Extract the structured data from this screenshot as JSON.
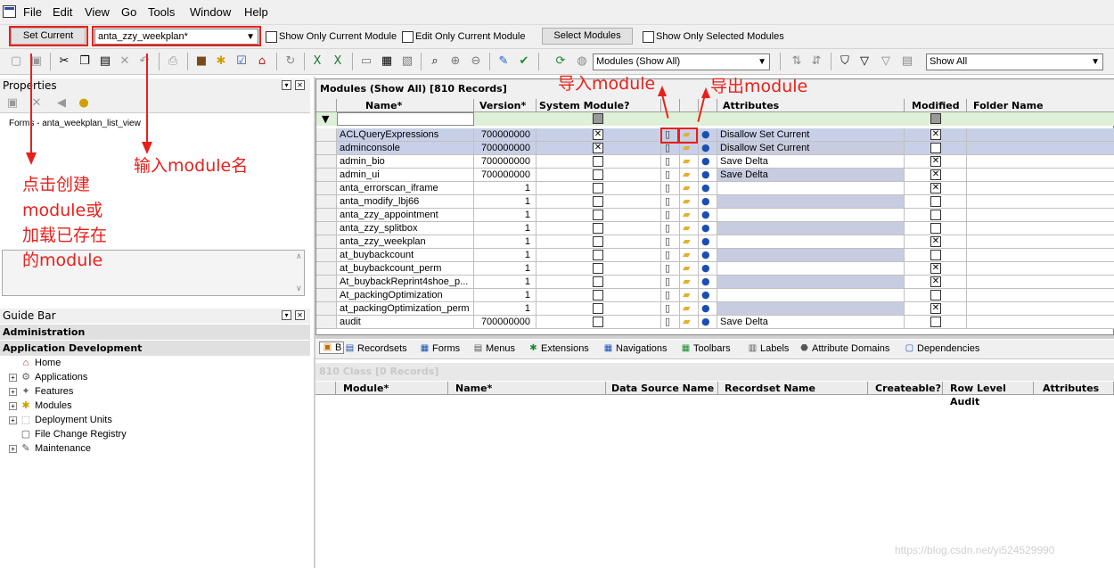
{
  "menubar": {
    "items": [
      "File",
      "Edit",
      "View",
      "Go",
      "Tools",
      "Window",
      "Help"
    ]
  },
  "toolbar1": {
    "set_current_label": "Set Current",
    "module_input_value": "anta_zzy_weekplan*",
    "show_only_current_module": "Show Only Current Module",
    "edit_only_current_module": "Edit Only Current Module",
    "select_modules_label": "Select Modules",
    "show_only_selected_modules": "Show Only Selected Modules"
  },
  "toolbar2": {
    "modules_combo_value": "Modules (Show All)",
    "show_all_combo_value": "Show All"
  },
  "properties": {
    "title": "Properties",
    "form_path": "Forms - anta_weekplan_list_view"
  },
  "guide_bar": {
    "title": "Guide Bar",
    "groups": [
      "Administration",
      "Application Development"
    ],
    "items": [
      {
        "label": "Home",
        "expandable": false,
        "icon": "home-icon"
      },
      {
        "label": "Applications",
        "expandable": true,
        "icon": "applications-icon"
      },
      {
        "label": "Features",
        "expandable": true,
        "icon": "features-icon"
      },
      {
        "label": "Modules",
        "expandable": true,
        "icon": "modules-icon"
      },
      {
        "label": "Deployment Units",
        "expandable": true,
        "icon": "deployment-units-icon"
      },
      {
        "label": "File Change Registry",
        "expandable": false,
        "icon": "file-icon"
      },
      {
        "label": "Maintenance",
        "expandable": true,
        "icon": "wrench-icon"
      }
    ]
  },
  "annotations": {
    "click_create": [
      "点击创建",
      "module或",
      "加载已存在",
      "的module"
    ],
    "input_module_name": "输入module名",
    "import_module": "导入module",
    "export_module": "导出module"
  },
  "modules_grid": {
    "title": "Modules (Show All) [810 Records]",
    "columns": [
      "Name*",
      "Version*",
      "System Module?",
      "",
      "",
      "",
      "Attributes",
      "Modified",
      "Folder Name"
    ],
    "rows": [
      {
        "name": "ACLQueryExpressions",
        "version": "700000000",
        "system": true,
        "attributes": "Disallow Set Current",
        "modified": true,
        "selected": true
      },
      {
        "name": "adminconsole",
        "version": "700000000",
        "system": true,
        "attributes": "Disallow Set Current",
        "modified": false,
        "selected": true
      },
      {
        "name": "admin_bio",
        "version": "700000000",
        "system": false,
        "attributes": "Save Delta",
        "modified": true,
        "selected": false
      },
      {
        "name": "admin_ui",
        "version": "700000000",
        "system": false,
        "attributes": "Save Delta",
        "modified": true,
        "selected": false
      },
      {
        "name": "anta_errorscan_iframe",
        "version": "1",
        "system": false,
        "attributes": "",
        "modified": true,
        "selected": false
      },
      {
        "name": "anta_modify_lbj66",
        "version": "1",
        "system": false,
        "attributes": "",
        "modified": false,
        "selected": false
      },
      {
        "name": "anta_zzy_appointment",
        "version": "1",
        "system": false,
        "attributes": "",
        "modified": false,
        "selected": false
      },
      {
        "name": "anta_zzy_splitbox",
        "version": "1",
        "system": false,
        "attributes": "",
        "modified": false,
        "selected": false
      },
      {
        "name": "anta_zzy_weekplan",
        "version": "1",
        "system": false,
        "attributes": "",
        "modified": true,
        "selected": false
      },
      {
        "name": "at_buybackcount",
        "version": "1",
        "system": false,
        "attributes": "",
        "modified": false,
        "selected": false
      },
      {
        "name": "at_buybackcount_perm",
        "version": "1",
        "system": false,
        "attributes": "",
        "modified": true,
        "selected": false
      },
      {
        "name": "At_buybackReprint4shoe_p...",
        "version": "1",
        "system": false,
        "attributes": "",
        "modified": true,
        "selected": false
      },
      {
        "name": "At_packingOptimization",
        "version": "1",
        "system": false,
        "attributes": "",
        "modified": false,
        "selected": false
      },
      {
        "name": "at_packingOptimization_perm",
        "version": "1",
        "system": false,
        "attributes": "",
        "modified": true,
        "selected": false
      },
      {
        "name": "audit",
        "version": "700000000",
        "system": false,
        "attributes": "Save Delta",
        "modified": false,
        "selected": false
      }
    ]
  },
  "bottom_tabs": [
    "B",
    "Recordsets",
    "Forms",
    "Menus",
    "Extensions",
    "Navigations",
    "Toolbars",
    "Labels",
    "Attribute Domains",
    "Dependencies"
  ],
  "class_grid": {
    "title": "810 Class [0 Records]",
    "columns": [
      "Module*",
      "Name*",
      "Data Source Name",
      "Recordset Name",
      "Createable?",
      "Row Level Audit",
      "Attributes"
    ]
  },
  "watermark": "https://blog.csdn.net/yi524529990",
  "colors": {
    "annotation_red": "#e8201b",
    "selected_row": "#c8d0e8",
    "filter_row": "#dff0d8",
    "stripe": "#c8cce0"
  }
}
